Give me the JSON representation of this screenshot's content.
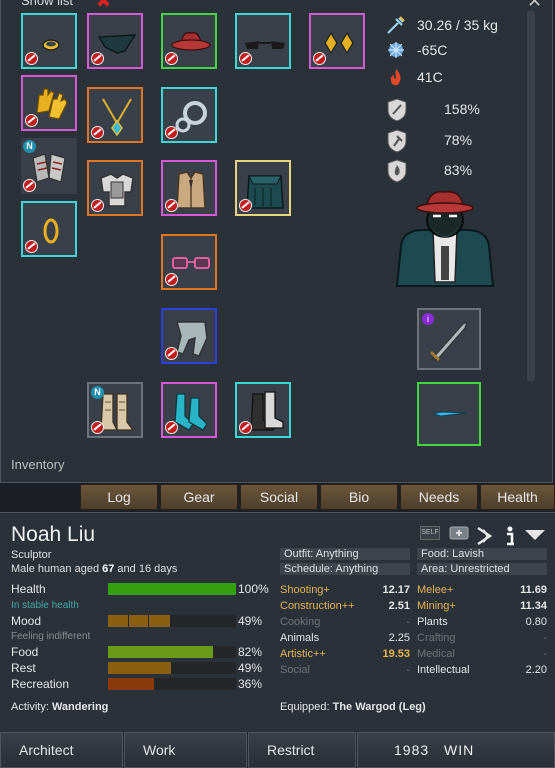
{
  "gear_panel": {
    "title": "Show list",
    "inventory_label": "Inventory",
    "mass": "30.26 / 35 kg",
    "comfy_temp_min": "-65C",
    "comfy_temp_max": "41C",
    "armor_sharp": "158%",
    "armor_blunt": "78%",
    "armor_heat": "83%",
    "slots": [
      {
        "item": "gold-ring-icon",
        "quality": "cyan"
      },
      {
        "item": "gloves-icon",
        "quality": "pink"
      },
      {
        "item": "power-armor-gauntlets-icon",
        "quality": "grey",
        "badge": "N"
      },
      {
        "item": "ring-icon",
        "quality": "cyan"
      },
      {
        "item": "face-mask-icon",
        "quality": "pink"
      },
      {
        "item": "necklace-icon",
        "quality": "orange"
      },
      {
        "item": "chest-armor-icon",
        "quality": "orange"
      },
      {
        "item": "cowboy-hat-icon",
        "quality": "green"
      },
      {
        "item": "handcuffs-icon",
        "quality": "cyan"
      },
      {
        "item": "vest-icon",
        "quality": "pink"
      },
      {
        "item": "glasses-pink-icon",
        "quality": "orange"
      },
      {
        "item": "pants-icon",
        "quality": "blue"
      },
      {
        "item": "sunglasses-icon",
        "quality": "cyan"
      },
      {
        "item": "fur-cape-icon",
        "quality": "yellow"
      },
      {
        "item": "earrings-icon",
        "quality": "pink"
      },
      {
        "item": "armored-boots-icon",
        "quality": "grey",
        "badge": "N"
      },
      {
        "item": "socks-icon",
        "quality": "pink"
      },
      {
        "item": "boots-icon",
        "quality": "cyan"
      },
      {
        "item": "sword-icon",
        "quality": "grey",
        "badge": "i"
      },
      {
        "item": "knife-icon",
        "quality": "green"
      }
    ]
  },
  "tabs": [
    "Log",
    "Gear",
    "Social",
    "Bio",
    "Needs",
    "Health"
  ],
  "pawn": {
    "name": "Noah Liu",
    "title": "Sculptor",
    "desc_prefix": "Male human aged ",
    "age": "67",
    "desc_suffix": " and 16 days"
  },
  "needs": [
    {
      "label": "Health",
      "value": "100%",
      "fraction": 1.0,
      "sub": "In stable health"
    },
    {
      "label": "Mood",
      "value": "49%",
      "fraction": 0.49,
      "sub": "Feeling indifferent"
    },
    {
      "label": "Food",
      "value": "82%",
      "fraction": 0.82
    },
    {
      "label": "Rest",
      "value": "49%",
      "fraction": 0.49
    },
    {
      "label": "Recreation",
      "value": "36%",
      "fraction": 0.36
    }
  ],
  "policies": {
    "outfit": "Outfit: Anything",
    "food": "Food: Lavish",
    "schedule": "Schedule: Anything",
    "area": "Area: Unrestricted"
  },
  "top_icons": {
    "self": "SELF"
  },
  "skills_left": [
    {
      "name": "Shooting+",
      "value": "12.17",
      "color": "gold"
    },
    {
      "name": "Construction++",
      "value": "2.51",
      "color": "gold"
    },
    {
      "name": "Cooking",
      "value": "-",
      "color": "grey"
    },
    {
      "name": "Animals",
      "value": "2.25",
      "color": "white"
    },
    {
      "name": "Artistic++",
      "value": "19.53",
      "color": "gold"
    },
    {
      "name": "Social",
      "value": "-",
      "color": "grey"
    }
  ],
  "skills_right": [
    {
      "name": "Melee+",
      "value": "11.69",
      "color": "gold"
    },
    {
      "name": "Mining+",
      "value": "11.34",
      "color": "gold"
    },
    {
      "name": "Plants",
      "value": "0.80",
      "color": "white"
    },
    {
      "name": "Crafting",
      "value": "-",
      "color": "grey"
    },
    {
      "name": "Medical",
      "value": "-",
      "color": "grey"
    },
    {
      "name": "Intellectual",
      "value": "2.20",
      "color": "white"
    }
  ],
  "activity_label": "Activity: ",
  "activity_value": "Wandering",
  "equipped_label": "Equipped: ",
  "equipped_value": "The Wargod (Leg)",
  "bottom_bar": [
    "Architect",
    "Work",
    "Restrict",
    "1983",
    "WIN"
  ]
}
